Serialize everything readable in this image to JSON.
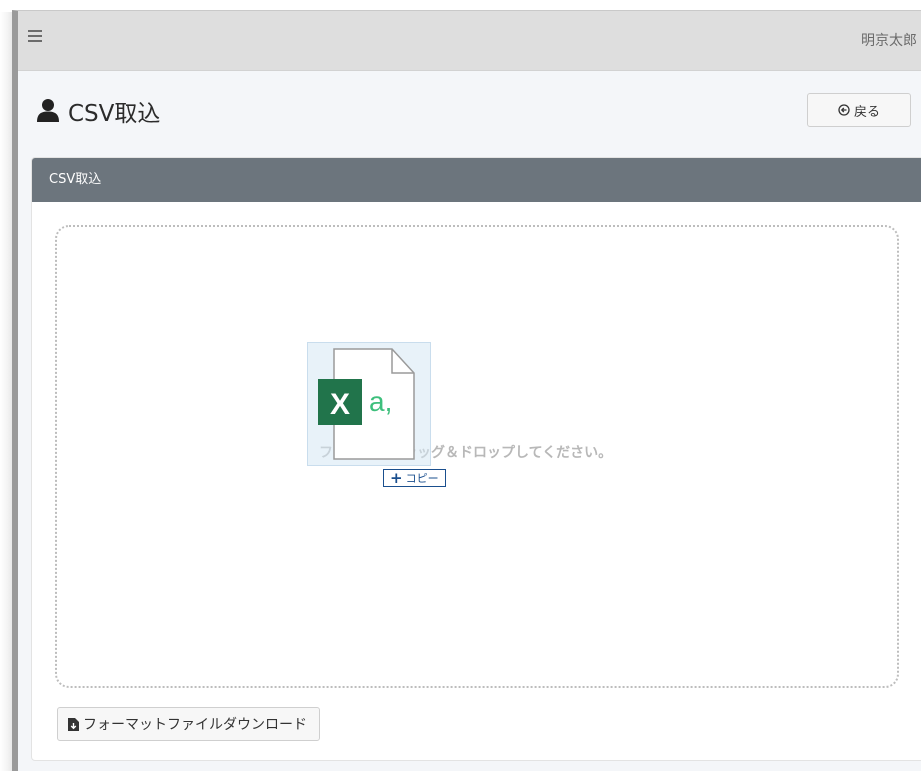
{
  "navbar": {
    "menu_icon": "hamburger-icon",
    "username": "明京太郎"
  },
  "page": {
    "title_icon": "user-icon",
    "title": "CSV取込",
    "back_icon": "arrow-circle-left-icon",
    "back_label": "戻る"
  },
  "card": {
    "header": "CSV取込",
    "dropzone_text": "ファイルをドラッグ＆ドロップしてください。",
    "drag_file": {
      "icon": "excel-csv-file-icon",
      "badge_letter": "X",
      "file_letters": "a,"
    },
    "copy_badge": {
      "symbol": "+",
      "label": "コピー"
    },
    "download_icon": "file-download-icon",
    "download_label": "フォーマットファイルダウンロード"
  },
  "colors": {
    "card_header_bg": "#6c757d",
    "navbar_bg": "#dedede",
    "excel_green": "#21744b",
    "csv_text_green": "#3dbf7c"
  }
}
